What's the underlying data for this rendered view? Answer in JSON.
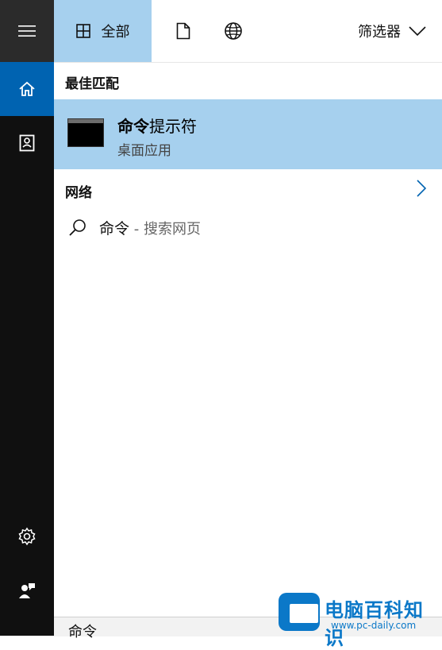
{
  "tabs": {
    "all_label": "全部",
    "filter_label": "筛选器"
  },
  "best_match": {
    "section_title": "最佳匹配",
    "app_name_bold": "命令",
    "app_name_rest": "提示符",
    "app_type": "桌面应用"
  },
  "web": {
    "section_title": "网络",
    "query": "命令",
    "suffix": " - 搜索网页"
  },
  "search_box": {
    "fragment": "命令"
  },
  "watermark": {
    "title": "电脑百科知识",
    "url": "www.pc-daily.com"
  },
  "colors": {
    "accent": "#0063b1",
    "selected": "#a6d0ee",
    "rail": "#101010"
  },
  "icons": [
    "hamburger-icon",
    "home-icon",
    "notebook-icon",
    "settings-icon",
    "feedback-icon",
    "grid-icon",
    "document-icon",
    "globe-icon",
    "chevron-down-icon",
    "chevron-right-icon",
    "search-icon"
  ]
}
